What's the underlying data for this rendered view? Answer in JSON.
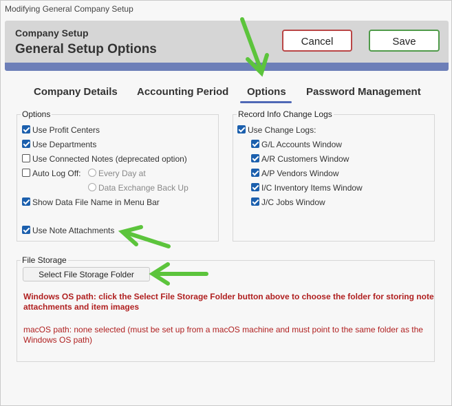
{
  "window": {
    "title": "Modifying General Company Setup"
  },
  "header": {
    "subtitle": "Company Setup",
    "title": "General Setup Options"
  },
  "actions": {
    "cancel_label": "Cancel",
    "save_label": "Save"
  },
  "tabs": [
    {
      "label": "Company Details",
      "active": false
    },
    {
      "label": "Accounting Period",
      "active": false
    },
    {
      "label": "Options",
      "active": true
    },
    {
      "label": "Password Management",
      "active": false
    }
  ],
  "options_group": {
    "title": "Options",
    "use_profit_centers": {
      "label": "Use Profit Centers",
      "checked": true
    },
    "use_departments": {
      "label": "Use Departments",
      "checked": true
    },
    "use_connected_notes": {
      "label": "Use Connected Notes (deprecated option)",
      "checked": false
    },
    "auto_log_off": {
      "label": "Auto Log Off:",
      "checked": false
    },
    "every_day_at": {
      "label": "Every Day at",
      "selected": false
    },
    "data_exchange_back_up": {
      "label": "Data Exchange Back Up",
      "selected": false
    },
    "show_data_file_name": {
      "label": "Show Data File Name in Menu Bar",
      "checked": true
    },
    "use_note_attachments": {
      "label": "Use Note Attachments",
      "checked": true
    }
  },
  "record_info_group": {
    "title": "Record Info Change Logs",
    "use_change_logs": {
      "label": "Use Change Logs:",
      "checked": true
    },
    "windows": [
      {
        "label": "G/L Accounts Window",
        "checked": true
      },
      {
        "label": "A/R Customers Window",
        "checked": true
      },
      {
        "label": "A/P Vendors Window",
        "checked": true
      },
      {
        "label": "I/C Inventory Items Window",
        "checked": true
      },
      {
        "label": "J/C Jobs Window",
        "checked": true
      }
    ]
  },
  "file_storage": {
    "title": "File Storage",
    "button_label": "Select File Storage Folder",
    "windows_path_note": "Windows OS path: click the Select File Storage Folder button above to choose the folder for storing note attachments and item images",
    "macos_path_note": "macOS path: none selected (must be set up from a macOS machine and must point to the same folder as the Windows OS path)"
  },
  "colors": {
    "accent": "#6d7fb8",
    "checkbox": "#1b5fad",
    "annotation_arrow": "#5cc43c",
    "note_text": "#b02020"
  }
}
